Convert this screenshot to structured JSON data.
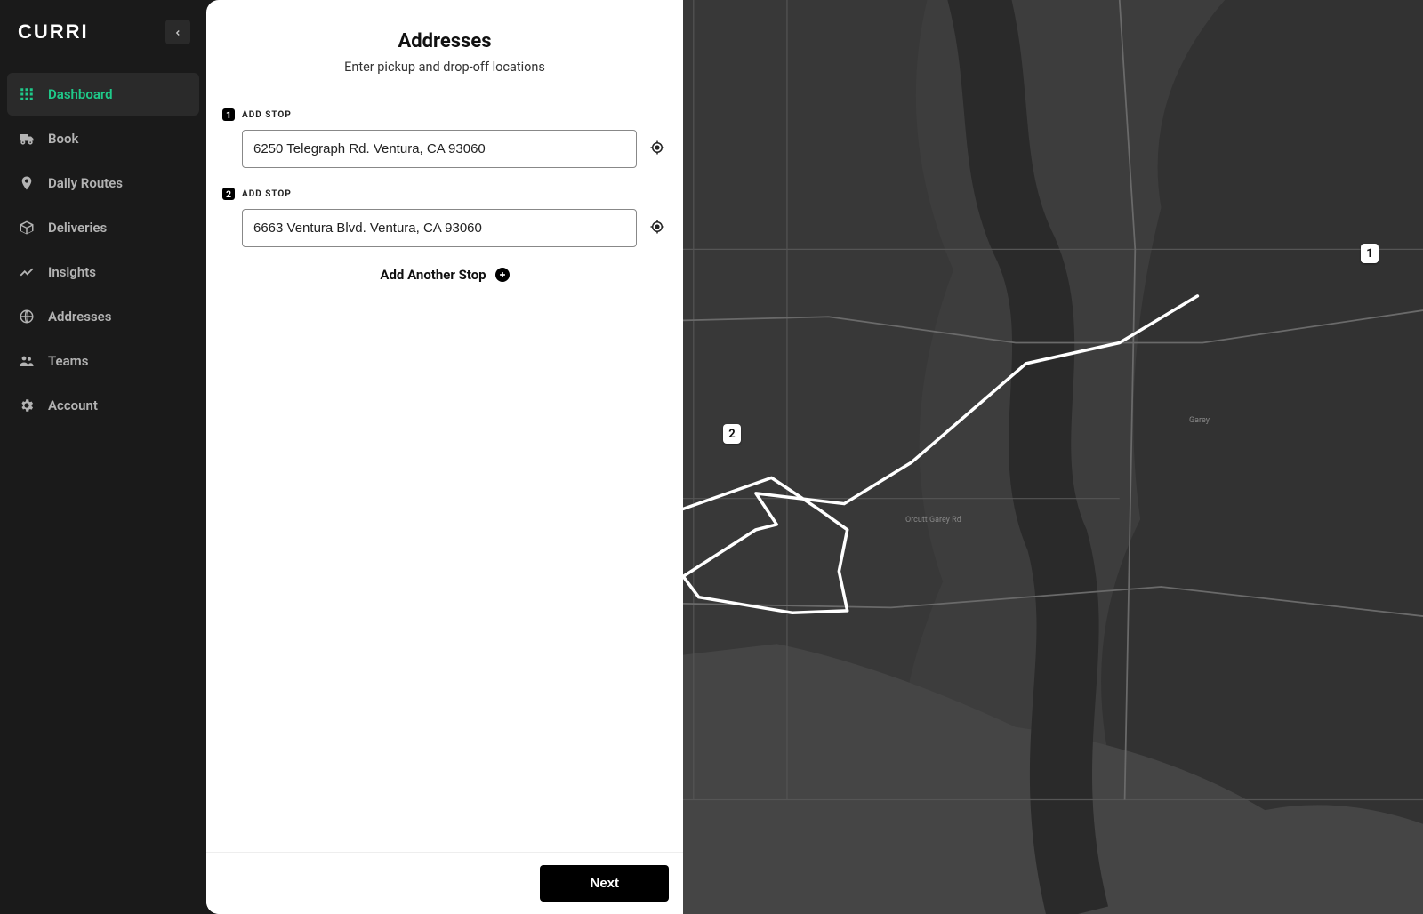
{
  "brand": "CURRI",
  "sidebar": {
    "items": [
      {
        "label": "Dashboard",
        "icon": "grid-icon",
        "active": true
      },
      {
        "label": "Book",
        "icon": "truck-icon",
        "active": false
      },
      {
        "label": "Daily Routes",
        "icon": "pin-icon",
        "active": false
      },
      {
        "label": "Deliveries",
        "icon": "package-icon",
        "active": false
      },
      {
        "label": "Insights",
        "icon": "chart-icon",
        "active": false
      },
      {
        "label": "Addresses",
        "icon": "globe-icon",
        "active": false
      },
      {
        "label": "Teams",
        "icon": "people-icon",
        "active": false
      },
      {
        "label": "Account",
        "icon": "gear-icon",
        "active": false
      }
    ]
  },
  "form": {
    "title": "Addresses",
    "subtitle": "Enter pickup and drop-off locations",
    "stop_label": "ADD STOP",
    "stops": [
      {
        "number": "1",
        "value": "6250 Telegraph Rd. Ventura, CA 93060"
      },
      {
        "number": "2",
        "value": "6663 Ventura Blvd. Ventura, CA 93060"
      }
    ],
    "add_another": "Add Another Stop",
    "next_button": "Next"
  },
  "map": {
    "markers": [
      {
        "label": "1"
      },
      {
        "label": "2"
      }
    ],
    "street_labels": [
      "Garey",
      "Orcutt Garey Rd"
    ]
  }
}
